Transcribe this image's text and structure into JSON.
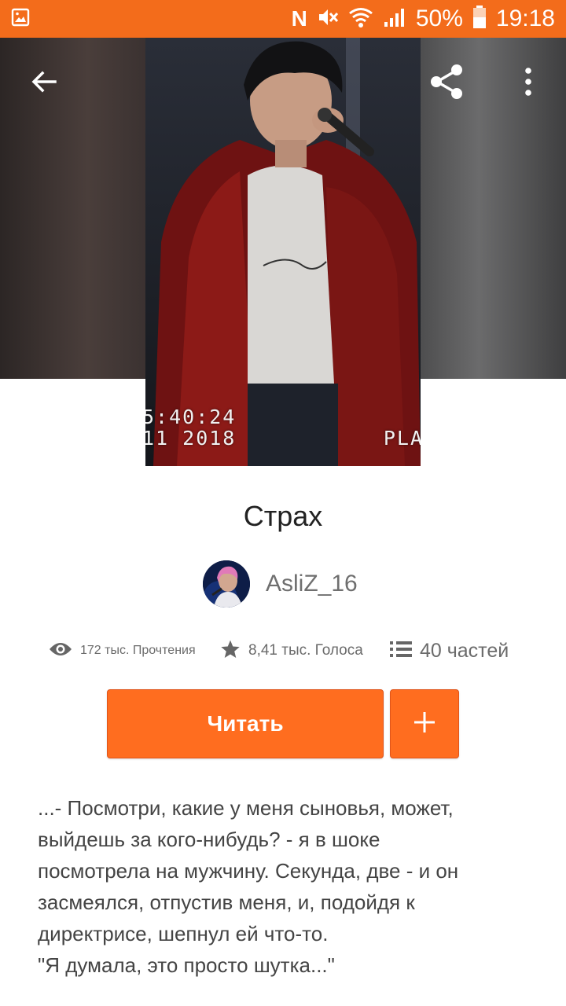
{
  "status_bar": {
    "battery": "50%",
    "time": "19:18",
    "network_letter": "N",
    "icons": [
      "gallery-notification-icon",
      "n-icon",
      "mute-icon",
      "wifi-icon",
      "signal-icon",
      "battery-icon"
    ]
  },
  "cover": {
    "overlay_time": "5:40:24",
    "overlay_date": "11 2018",
    "overlay_play": "PLA"
  },
  "toolbar": {
    "icons": [
      "back-arrow-icon",
      "share-icon",
      "more-vert-icon"
    ]
  },
  "story": {
    "title": "Страх",
    "author": "AsliZ_16",
    "reads": "172 тыс. Прочтения",
    "votes": "8,41 тыс. Голоса",
    "parts": "40 частей"
  },
  "actions": {
    "read_label": "Читать",
    "add_label": "+"
  },
  "description": {
    "lines": [
      "...- Посмотри, какие у меня сыновья, может,",
      "выйдешь за кого-нибудь? - я в шоке",
      "посмотрела на мужчину. Секунда, две - и он",
      "засмеялся, отпустив меня, и, подойдя к",
      "директрисе, шепнул ей что-то.",
      "\"Я думала, это просто шутка...\""
    ]
  },
  "colors": {
    "accent": "#ff6d1f",
    "status_bar": "#f36c1b"
  }
}
